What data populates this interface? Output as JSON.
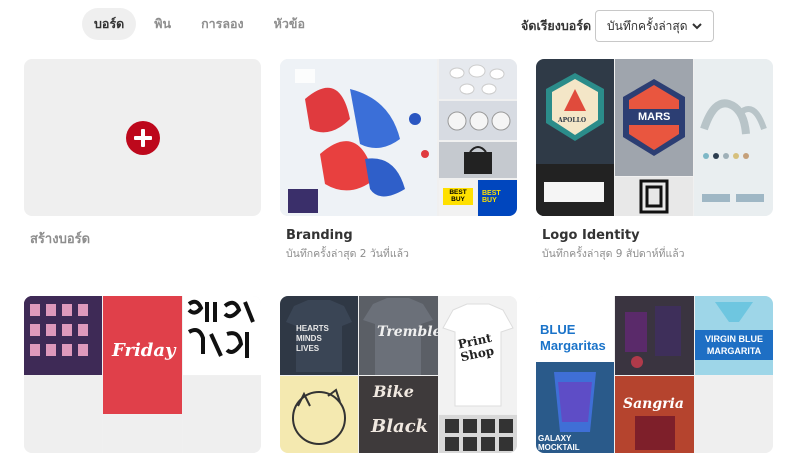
{
  "tabs": [
    {
      "label": "บอร์ด",
      "active": true
    },
    {
      "label": "พิน",
      "active": false
    },
    {
      "label": "การลอง",
      "active": false
    },
    {
      "label": "หัวข้อ",
      "active": false
    }
  ],
  "sort": {
    "label": "จัดเรียงบอร์ด",
    "selected": "บันทึกครั้งล่าสุด"
  },
  "create_board": {
    "label": "สร้างบอร์ด"
  },
  "boards": [
    {
      "title": "Branding",
      "subtitle": "บันทึกครั้งล่าสุด 2 วันที่แล้ว"
    },
    {
      "title": "Logo Identity",
      "subtitle": "บันทึกครั้งล่าสุด 9 สัปดาห์ที่แล้ว"
    }
  ],
  "cover_text": {
    "bestbuy_1": "BEST BUY",
    "bestbuy_2": "BEST BUY",
    "apollo": "APOLLO",
    "mars": "MARS",
    "friday": "Friday",
    "hearts": "HEARTS MINDS LIVES",
    "tremble": "Tremble",
    "print_shop": "Print Shop",
    "bike": "Bike",
    "black": "Black",
    "blue_margaritas": "BLUE Margaritas",
    "sangria": "Sangria",
    "galaxy": "GALAXY MOCKTAIL",
    "virgin": "VIRGIN BLUE MARGARITA"
  },
  "colors": {
    "brand_red": "#bd081c",
    "text_dark": "#333333",
    "text_muted": "#8e8e8e"
  }
}
